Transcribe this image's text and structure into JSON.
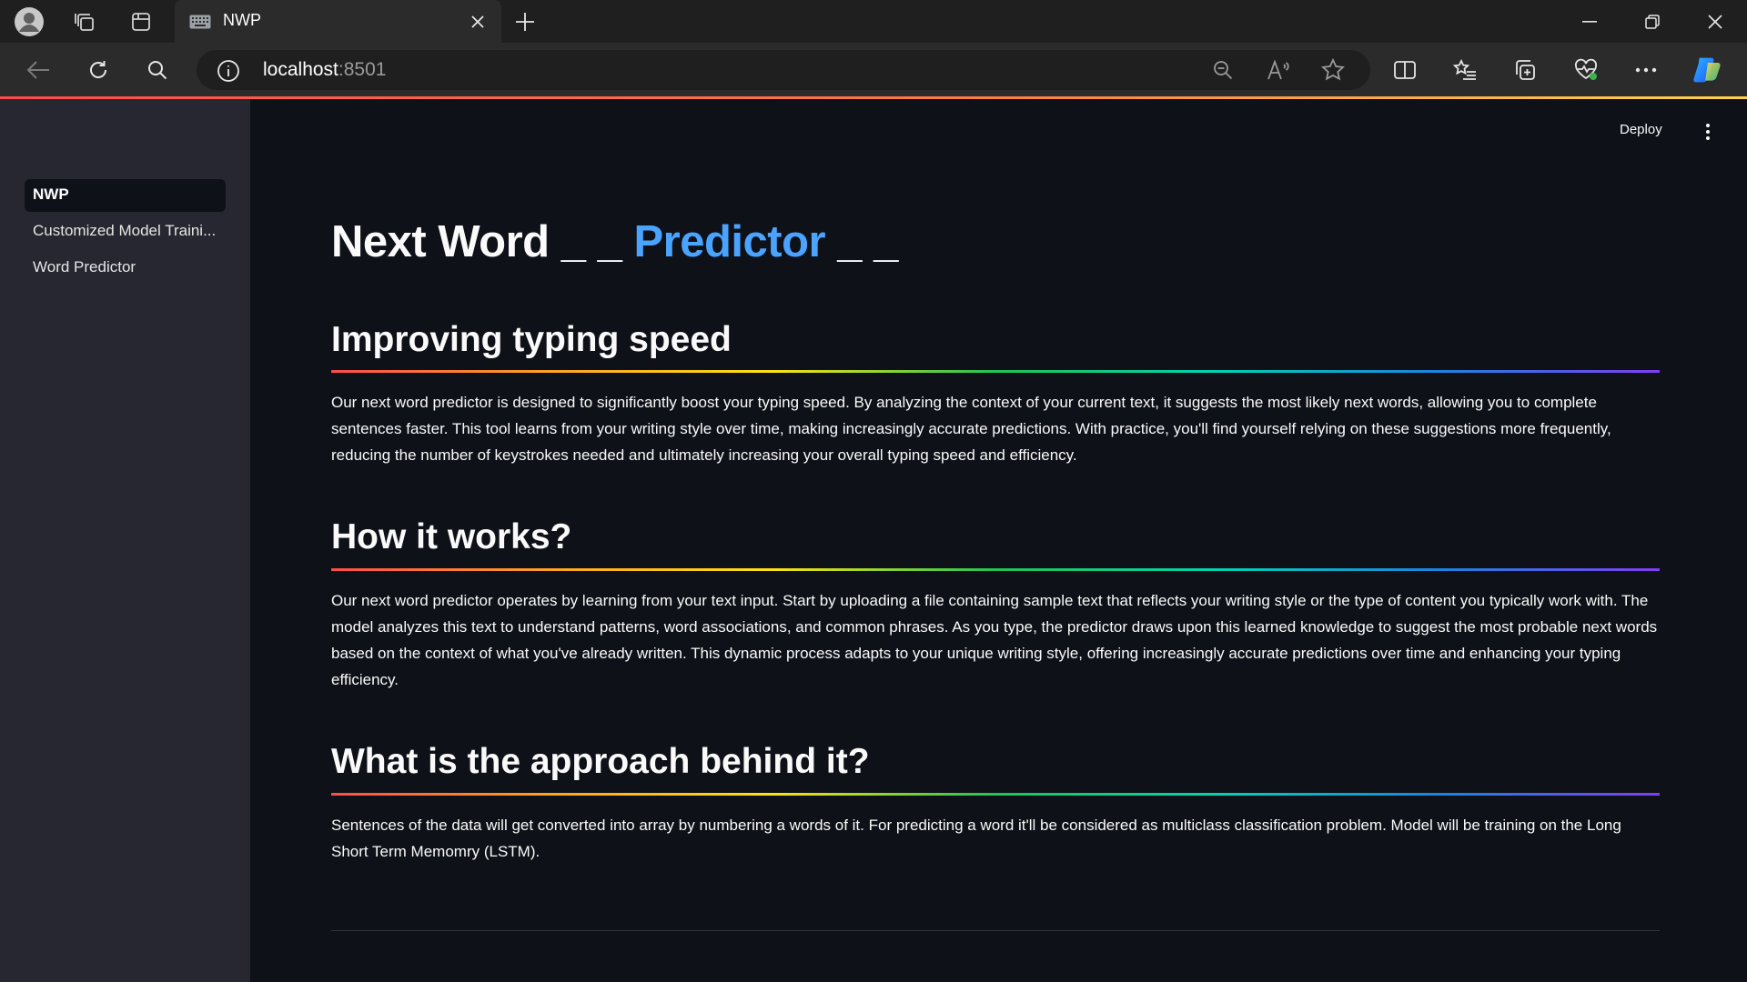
{
  "browser": {
    "tab_title": "NWP",
    "address_host": "localhost",
    "address_port": ":8501"
  },
  "sidebar": {
    "items": [
      {
        "label": "NWP",
        "active": true
      },
      {
        "label": "Customized Model Traini...",
        "active": false
      },
      {
        "label": "Word Predictor",
        "active": false
      }
    ]
  },
  "header": {
    "deploy_label": "Deploy"
  },
  "main": {
    "title_part1": "Next Word _ _",
    "title_accent": "Predictor",
    "title_part2": "_ _",
    "sections": [
      {
        "heading": "Improving typing speed",
        "text": "Our next word predictor is designed to significantly boost your typing speed. By analyzing the context of your current text, it suggests the most likely next words, allowing you to complete sentences faster. This tool learns from your writing style over time, making increasingly accurate predictions. With practice, you'll find yourself relying on these suggestions more frequently, reducing the number of keystrokes needed and ultimately increasing your overall typing speed and efficiency."
      },
      {
        "heading": "How it works?",
        "text": "Our next word predictor operates by learning from your text input. Start by uploading a file containing sample text that reflects your writing style or the type of content you typically work with. The model analyzes this text to understand patterns, word associations, and common phrases. As you type, the predictor draws upon this learned knowledge to suggest the most probable next words based on the context of what you've already written. This dynamic process adapts to your unique writing style, offering increasingly accurate predictions over time and enhancing your typing efficiency."
      },
      {
        "heading": "What is the approach behind it?",
        "text": "Sentences of the data will get converted into array by numbering a words of it. For predicting a word it'll be considered as multiclass classification problem. Model will be training on the Long Short Term Memomry (LSTM)."
      }
    ]
  },
  "colors": {
    "accent_blue": "#4aa3ff",
    "background": "#0e1117",
    "sidebar_background": "#262730",
    "streamlit_red": "#ff4b4b"
  }
}
